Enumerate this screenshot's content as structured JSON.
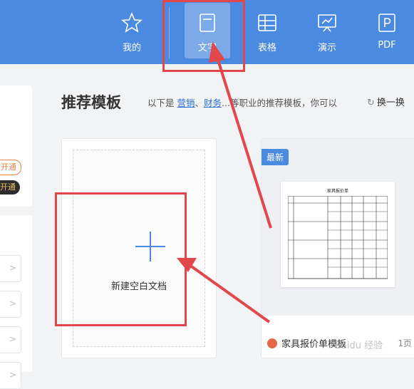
{
  "topbar": {
    "tabs": [
      {
        "label": "我的",
        "icon": "star-icon"
      },
      {
        "label": "文字",
        "icon": "document-icon"
      },
      {
        "label": "表格",
        "icon": "table-icon"
      },
      {
        "label": "演示",
        "icon": "presentation-icon"
      },
      {
        "label": "PDF",
        "icon": "pdf-icon"
      }
    ]
  },
  "left": {
    "badge1": "开通",
    "badge2": "开通"
  },
  "section": {
    "title": "推荐模板",
    "hint_prefix": "以下是",
    "hint_link1": "营销",
    "hint_sep": "、",
    "hint_link2": "财务",
    "hint_suffix": "...等职业的推荐模板，你可以",
    "refresh": "换一换"
  },
  "new_card": {
    "label": "新建空白文档"
  },
  "template_card": {
    "tag": "最新",
    "doc_title": "家具报价单",
    "name": "家具报价单模板",
    "pages": "1页"
  },
  "watermark": "Baidu 经验",
  "colors": {
    "brand_blue": "#4a8ae0",
    "annotation_red": "#e2474b"
  }
}
